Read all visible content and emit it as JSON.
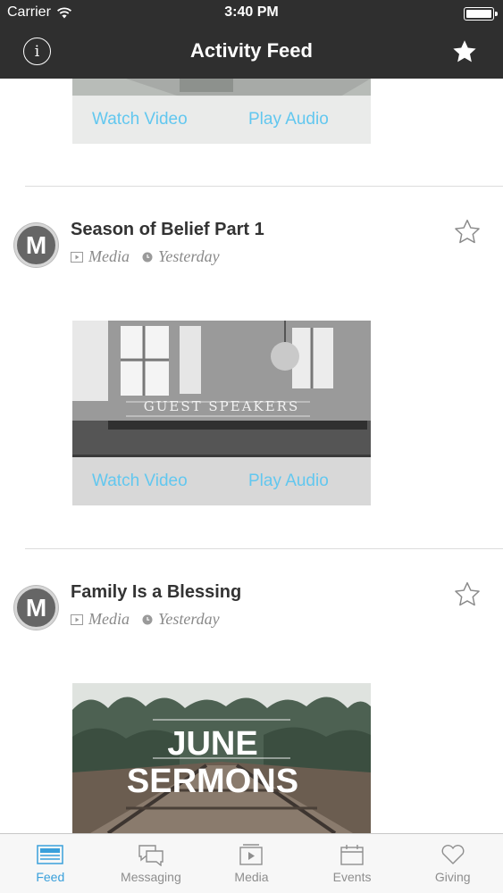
{
  "status_bar": {
    "carrier": "Carrier",
    "time": "3:40 PM"
  },
  "nav": {
    "title": "Activity Feed",
    "info_glyph": "i"
  },
  "media_actions": {
    "watch": "Watch Video",
    "audio": "Play Audio"
  },
  "posts": [
    {
      "avatar_letter": "M",
      "title": "Season of Belief Part 1",
      "type": "Media",
      "date": "Yesterday",
      "image_caption": "GUEST SPEAKERS"
    },
    {
      "avatar_letter": "M",
      "title": "Family Is a Blessing",
      "type": "Media",
      "date": "Yesterday",
      "image_caption_line1": "JUNE",
      "image_caption_line2": "SERMONS"
    }
  ],
  "tabs": [
    {
      "label": "Feed",
      "icon": "feed-icon",
      "active": true
    },
    {
      "label": "Messaging",
      "icon": "messaging-icon",
      "active": false
    },
    {
      "label": "Media",
      "icon": "media-icon",
      "active": false
    },
    {
      "label": "Events",
      "icon": "events-icon",
      "active": false
    },
    {
      "label": "Giving",
      "icon": "giving-icon",
      "active": false
    }
  ],
  "colors": {
    "nav_bg": "#2f2f2f",
    "accent_link": "#62c7ef",
    "tab_active": "#3aa0db",
    "tab_inactive": "#8e8e8e"
  }
}
